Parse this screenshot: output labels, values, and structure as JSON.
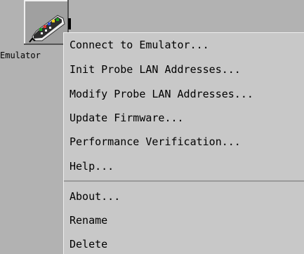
{
  "icon": {
    "label": "Emulator",
    "name": "emulator-icon"
  },
  "menu": {
    "items": [
      {
        "label": "Connect to Emulator..."
      },
      {
        "label": "Init Probe LAN Addresses..."
      },
      {
        "label": "Modify Probe LAN Addresses..."
      },
      {
        "label": "Update Firmware..."
      },
      {
        "label": "Performance Verification..."
      },
      {
        "label": "Help..."
      },
      {
        "label": "About..."
      },
      {
        "label": "Rename"
      },
      {
        "label": "Delete"
      }
    ]
  }
}
